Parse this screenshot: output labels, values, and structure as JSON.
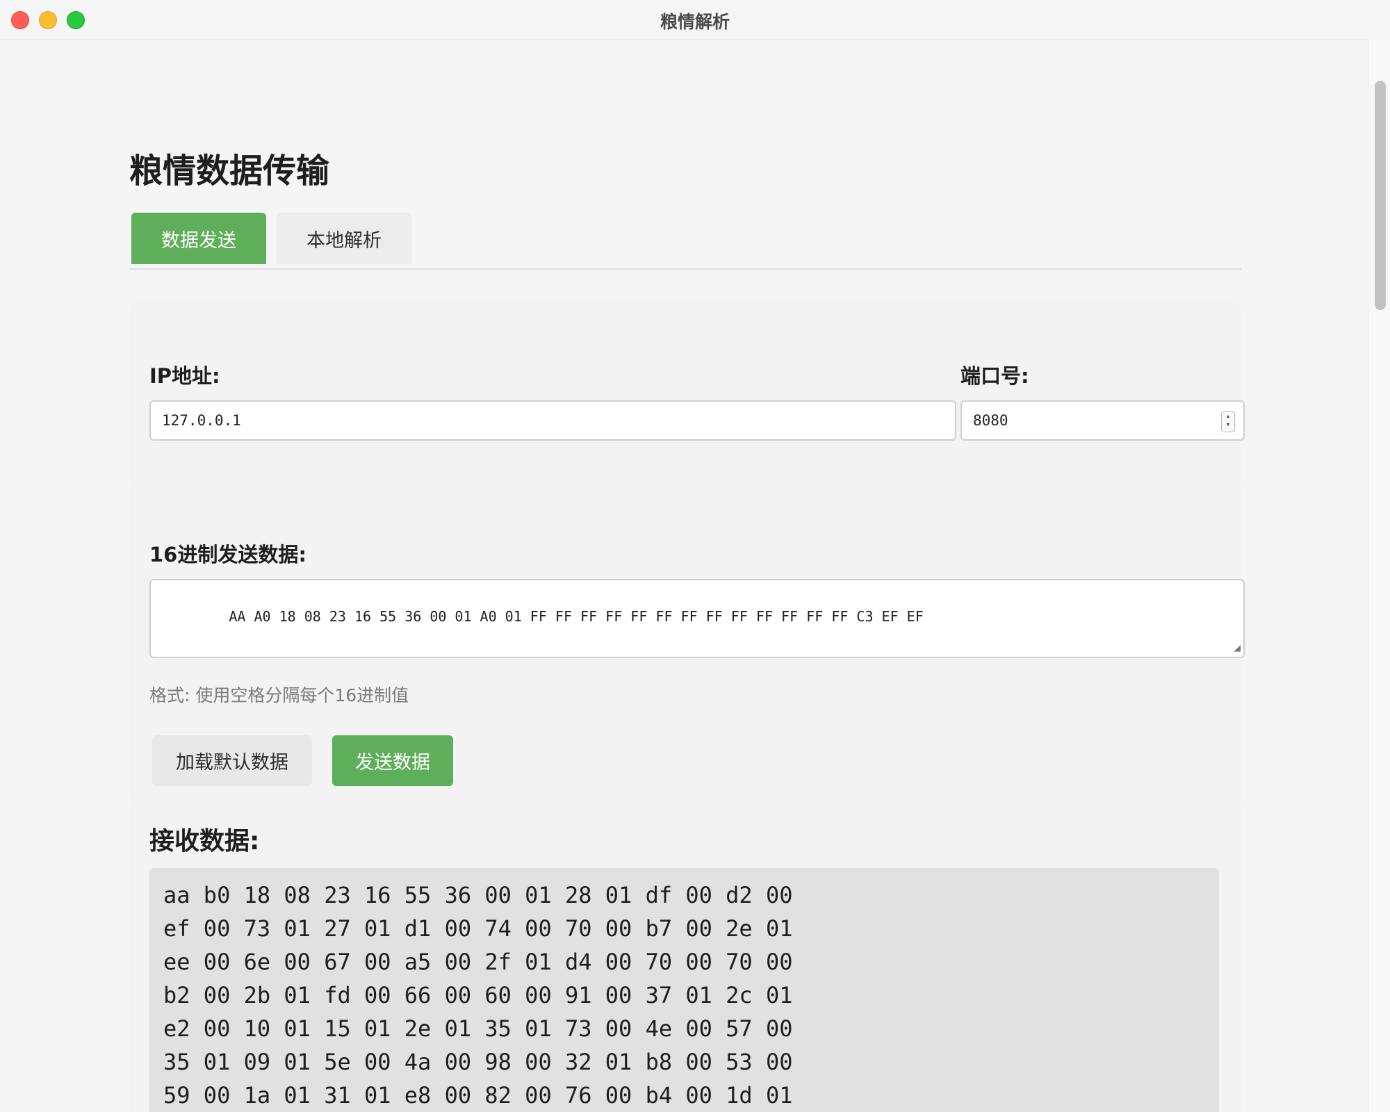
{
  "window": {
    "title": "粮情解析"
  },
  "page": {
    "title": "粮情数据传输"
  },
  "tabs": [
    {
      "label": "数据发送",
      "active": true
    },
    {
      "label": "本地解析",
      "active": false
    }
  ],
  "connection": {
    "ip_label": "IP地址:",
    "ip_value": "127.0.0.1",
    "port_label": "端口号:",
    "port_value": "8080"
  },
  "hex": {
    "label": "16进制发送数据:",
    "value": "AA A0 18 08 23 16 55 36 00 01 A0 01 FF FF FF FF FF FF FF FF FF FF FF FF FF C3 EF EF",
    "hint": "格式: 使用空格分隔每个16进制值",
    "load_default_label": "加载默认数据",
    "send_label": "发送数据"
  },
  "received": {
    "title": "接收数据:",
    "lines": [
      "aa b0 18 08 23 16 55 36 00 01 28 01 df 00 d2 00",
      "ef 00 73 01 27 01 d1 00 74 00 70 00 b7 00 2e 01",
      "ee 00 6e 00 67 00 a5 00 2f 01 d4 00 70 00 70 00",
      "b2 00 2b 01 fd 00 66 00 60 00 91 00 37 01 2c 01",
      "e2 00 10 01 15 01 2e 01 35 01 73 00 4e 00 57 00",
      "35 01 09 01 5e 00 4a 00 98 00 32 01 b8 00 53 00",
      "59 00 1a 01 31 01 e8 00 82 00 76 00 b4 00 1d 01"
    ]
  },
  "colors": {
    "accent_green": "#5fae5a",
    "close": "#fe5f57",
    "minimize": "#febc2e",
    "maximize": "#28c840"
  }
}
